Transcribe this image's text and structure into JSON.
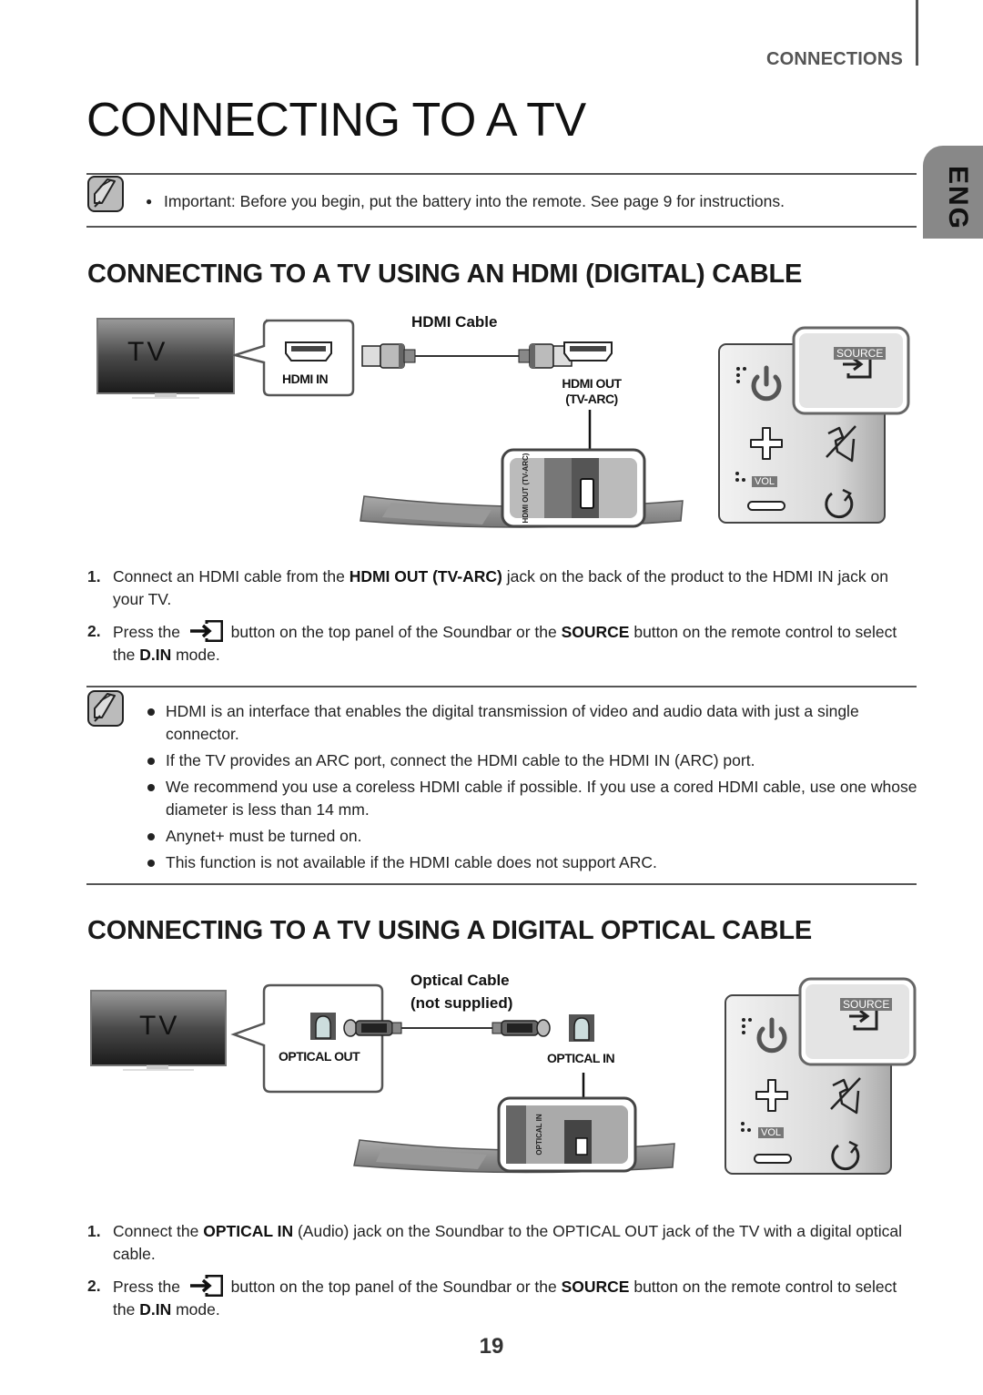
{
  "header": {
    "section": "CONNECTIONS",
    "language_tab": "ENG"
  },
  "page_title": "CONNECTING TO A TV",
  "note_top": {
    "icon": "note-pencil-icon",
    "items": [
      "Important: Before you begin, put the battery into the remote. See page 9 for instructions."
    ]
  },
  "hdmi_section": {
    "heading": "CONNECTING TO A TV USING AN HDMI (DIGITAL) CABLE",
    "diagram": {
      "tv_label": "TV",
      "cable_label": "HDMI Cable",
      "tv_port_label": "HDMI IN",
      "soundbar_port_label_line1": "HDMI OUT",
      "soundbar_port_label_line2": "(TV-ARC)",
      "soundbar_closeup_label": "HDMI OUT (TV-ARC)",
      "remote": {
        "source_label": "SOURCE",
        "vol_label": "VOL",
        "buttons": [
          "power-icon",
          "source-icon",
          "volume-up-icon",
          "mute-icon",
          "volume-down-icon",
          "repeat-icon"
        ]
      }
    },
    "steps": [
      {
        "num": "1.",
        "parts": [
          "Connect an HDMI cable from the ",
          "HDMI OUT (TV-ARC)",
          " jack on the back of the product to the HDMI IN jack on your TV."
        ]
      },
      {
        "num": "2.",
        "parts": [
          "Press the ",
          " button on the top panel of the Soundbar or the ",
          "SOURCE",
          " button on the remote control to select the ",
          "D.IN",
          " mode."
        ]
      }
    ],
    "notes": [
      "HDMI is an interface that enables the digital transmission of video and audio data with just a single connector.",
      "If the TV provides an ARC port, connect the HDMI cable to the HDMI IN (ARC) port.",
      "We recommend you use a coreless HDMI cable if possible. If you use a cored HDMI cable, use one whose diameter is less than 14 mm.",
      "Anynet+ must be turned on.",
      "This function is not available if the HDMI cable does not support ARC."
    ]
  },
  "optical_section": {
    "heading": "CONNECTING TO A TV USING A DIGITAL OPTICAL CABLE",
    "diagram": {
      "tv_label": "TV",
      "cable_label_line1": "Optical Cable",
      "cable_label_line2": "(not supplied)",
      "tv_port_label": "OPTICAL OUT",
      "soundbar_port_label": "OPTICAL IN",
      "soundbar_closeup_label": "OPTICAL IN",
      "remote": {
        "source_label": "SOURCE",
        "vol_label": "VOL"
      }
    },
    "steps": [
      {
        "num": "1.",
        "parts": [
          "Connect the ",
          "OPTICAL IN",
          " (Audio) jack on the Soundbar to the OPTICAL OUT jack of the TV with a digital optical cable."
        ]
      },
      {
        "num": "2.",
        "parts": [
          "Press the ",
          " button on the top panel of the Soundbar or the ",
          "SOURCE",
          " button on the remote control to select the ",
          "D.IN",
          " mode."
        ]
      }
    ]
  },
  "footer": {
    "page_number": "19"
  }
}
